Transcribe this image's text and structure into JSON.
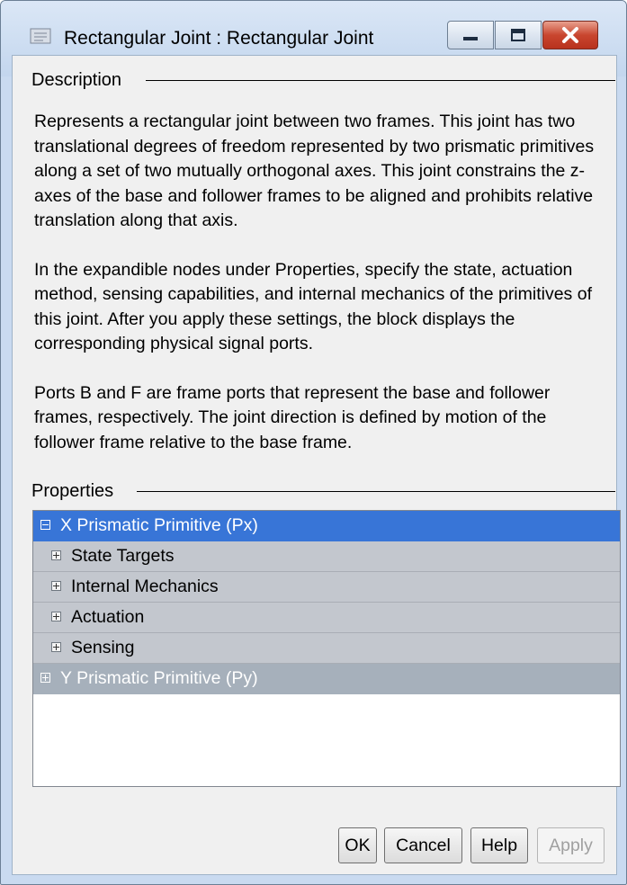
{
  "window": {
    "title": "Rectangular Joint : Rectangular  Joint",
    "icons": [
      "block-icon",
      "minimize-icon",
      "maximize-icon",
      "close-icon"
    ]
  },
  "description": {
    "label": "Description",
    "paragraphs": [
      "Represents a rectangular joint between two frames. This joint has two translational degrees of freedom represented by two prismatic primitives along a set of two mutually orthogonal axes. This joint constrains the z-axes of the base and follower frames to be aligned and prohibits relative translation along that axis.",
      "In the expandible nodes under Properties, specify the state, actuation method, sensing capabilities, and internal mechanics of the primitives of this joint. After you apply these settings, the block displays the corresponding physical signal ports.",
      "Ports B and F are frame ports that represent the base and follower frames, respectively. The joint direction is defined by motion of the follower frame relative to the base frame."
    ]
  },
  "properties": {
    "label": "Properties",
    "nodes": [
      {
        "label": "X Prismatic Primitive (Px)",
        "state": "expanded",
        "level": 0,
        "selected": true
      },
      {
        "label": "State Targets",
        "state": "collapsed",
        "level": 1
      },
      {
        "label": "Internal Mechanics",
        "state": "collapsed",
        "level": 1
      },
      {
        "label": "Actuation",
        "state": "collapsed",
        "level": 1
      },
      {
        "label": "Sensing",
        "state": "collapsed",
        "level": 1
      },
      {
        "label": "Y Prismatic Primitive (Py)",
        "state": "collapsed",
        "level": 0
      }
    ]
  },
  "buttons": {
    "ok": "OK",
    "cancel": "Cancel",
    "help": "Help",
    "apply": "Apply",
    "apply_enabled": false
  },
  "colors": {
    "selection": "#3875d7",
    "subnode_bg": "#c3c7ce",
    "collapsed_node_bg": "#a6b0bb",
    "close_button": "#c9462f"
  }
}
